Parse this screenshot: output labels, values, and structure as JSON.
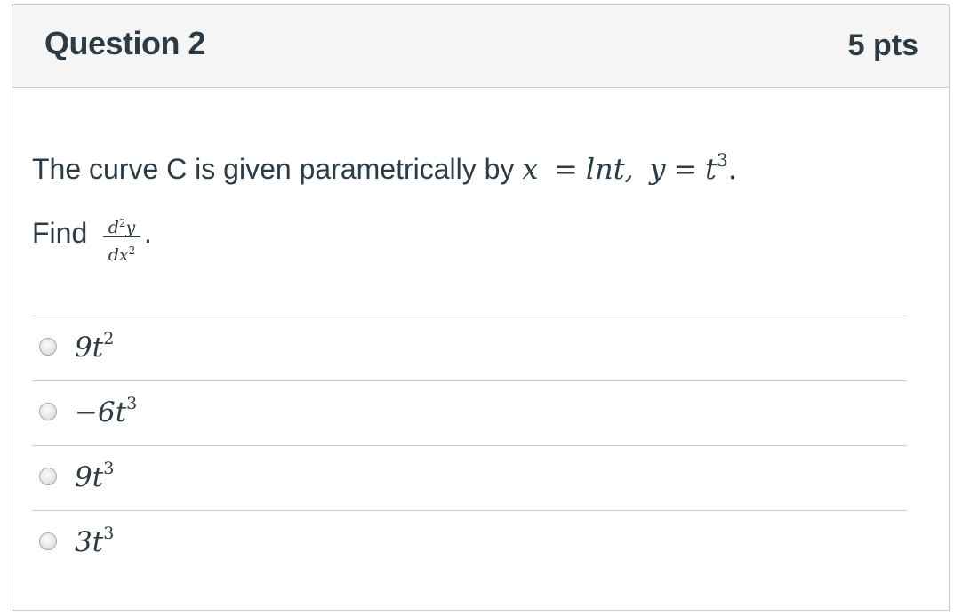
{
  "question": {
    "title": "Question 2",
    "points": "5 pts"
  },
  "prompt": {
    "text": "The curve C is given parametrically by",
    "eq_x": "x",
    "eq_eq1": "=",
    "eq_lnt": "lnt,",
    "eq_y": "y",
    "eq_eq2": "=",
    "eq_t": "t",
    "eq_t_exp": "3",
    "eq_end": ".",
    "find_label": "Find",
    "frac_num": "d",
    "frac_num_exp": "2",
    "frac_num_var": "y",
    "frac_den": "dx",
    "frac_den_exp": "2",
    "frac_end": "."
  },
  "answers": [
    {
      "base": "9t",
      "exp": "2"
    },
    {
      "base": "−6t",
      "exp": "3"
    },
    {
      "base": "9t",
      "exp": "3"
    },
    {
      "base": "3t",
      "exp": "3"
    }
  ]
}
